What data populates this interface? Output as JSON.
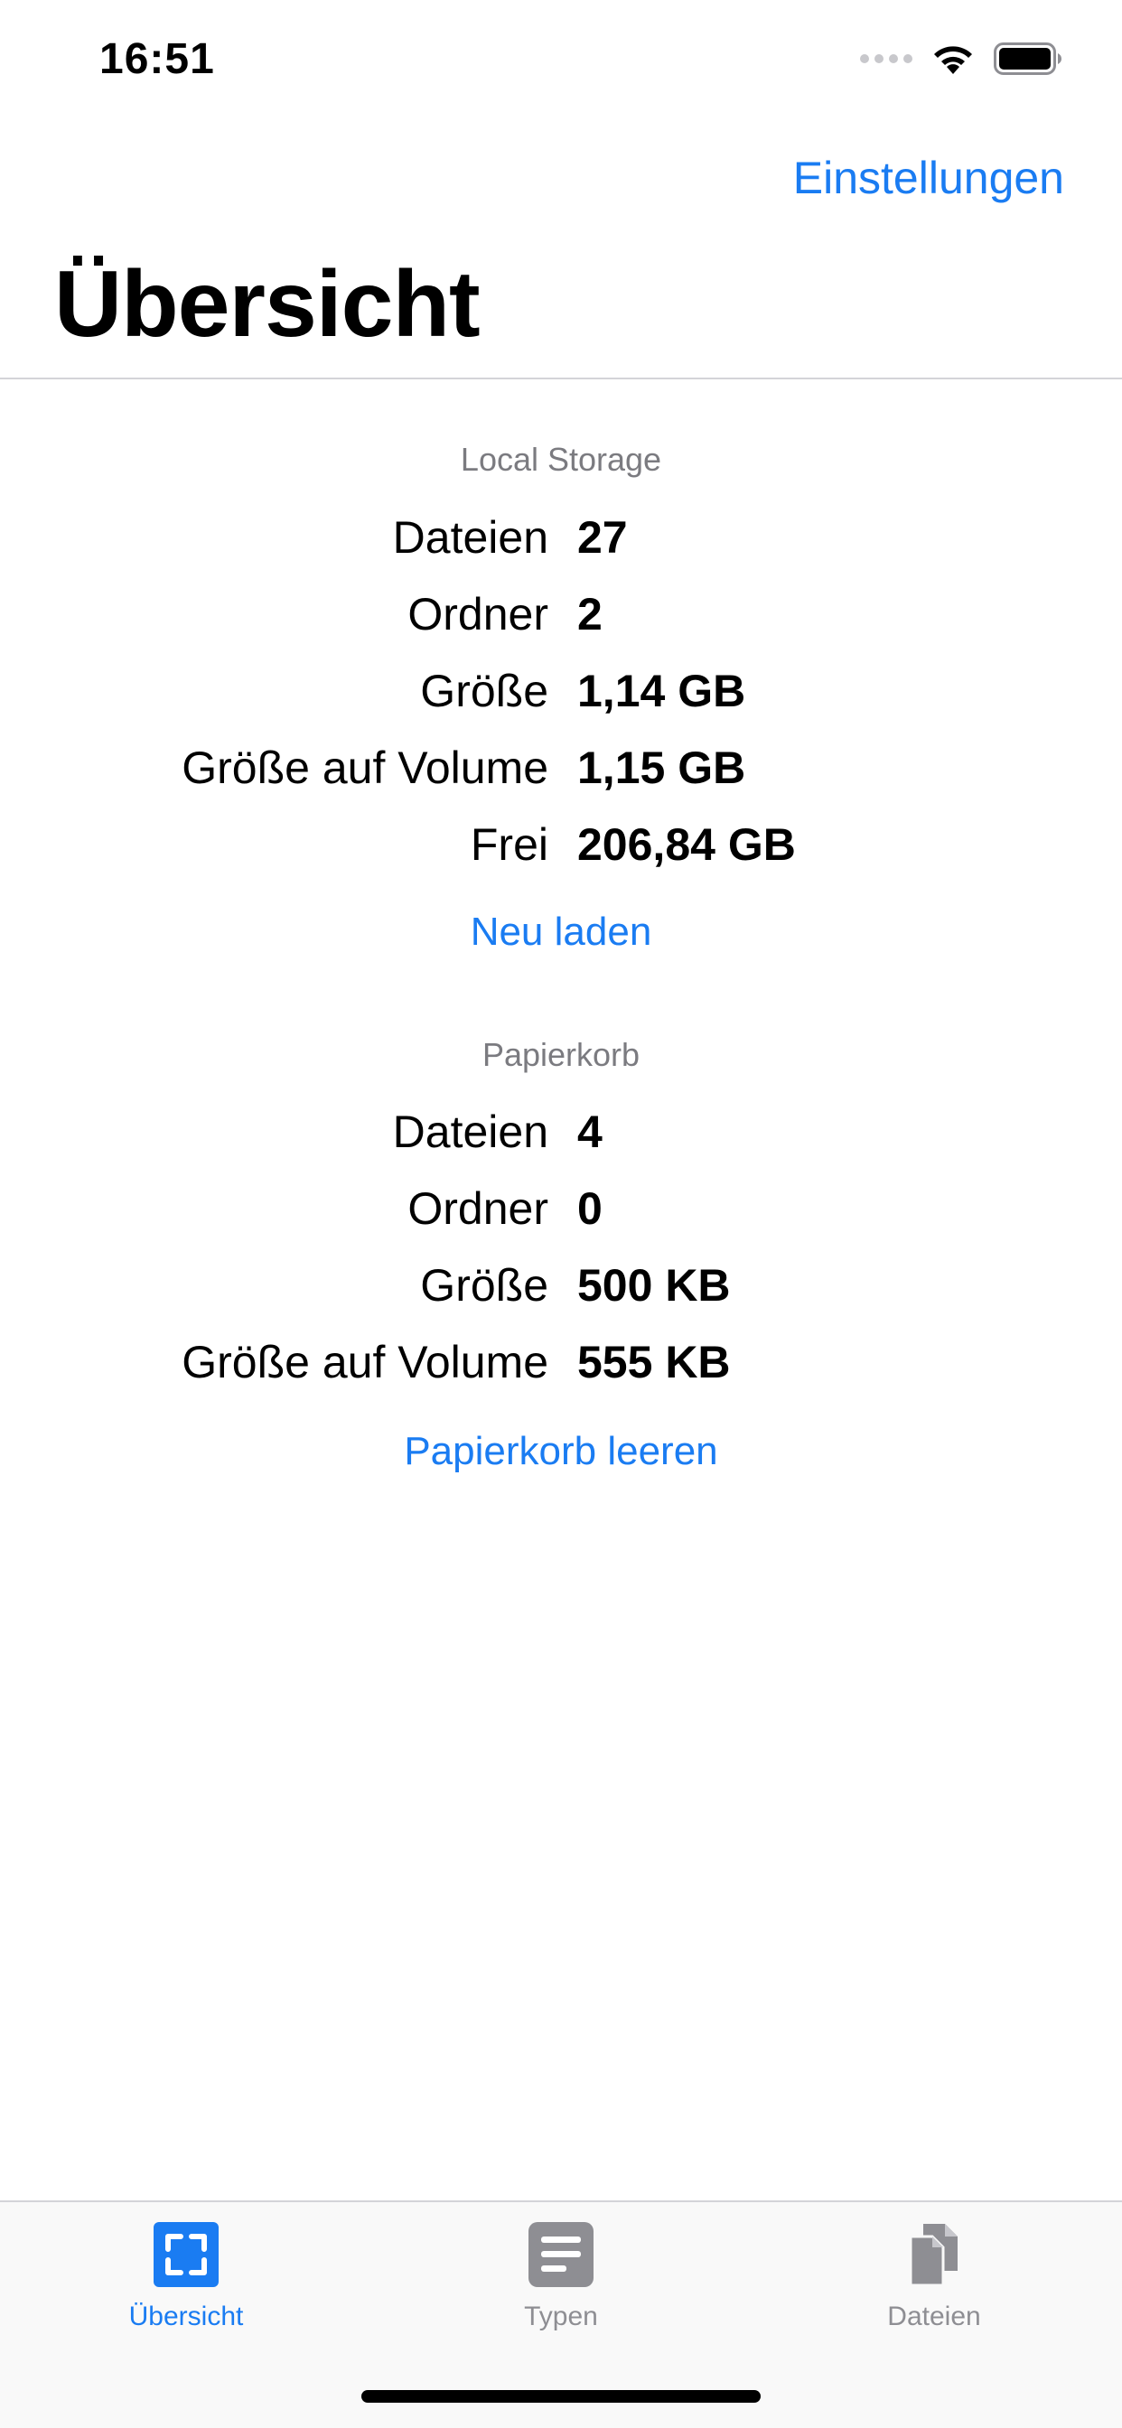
{
  "status_bar": {
    "time": "16:51"
  },
  "nav": {
    "right_button": "Einstellungen",
    "title": "Übersicht"
  },
  "local_storage": {
    "header": "Local Storage",
    "rows": [
      {
        "label": "Dateien",
        "value": "27"
      },
      {
        "label": "Ordner",
        "value": "2"
      },
      {
        "label": "Größe",
        "value": "1,14 GB"
      },
      {
        "label": "Größe auf Volume",
        "value": "1,15 GB"
      },
      {
        "label": "Frei",
        "value": "206,84 GB"
      }
    ],
    "action": "Neu laden"
  },
  "trash": {
    "header": "Papierkorb",
    "rows": [
      {
        "label": "Dateien",
        "value": "4"
      },
      {
        "label": "Ordner",
        "value": "0"
      },
      {
        "label": "Größe",
        "value": "500 KB"
      },
      {
        "label": "Größe auf Volume",
        "value": "555 KB"
      }
    ],
    "action": "Papierkorb leeren"
  },
  "tabbar": {
    "tabs": [
      {
        "label": "Übersicht",
        "icon": "overview-icon",
        "active": true
      },
      {
        "label": "Typen",
        "icon": "types-icon",
        "active": false
      },
      {
        "label": "Dateien",
        "icon": "files-icon",
        "active": false
      }
    ]
  },
  "colors": {
    "accent": "#1a7cf2",
    "inactive": "#8e8e93"
  }
}
